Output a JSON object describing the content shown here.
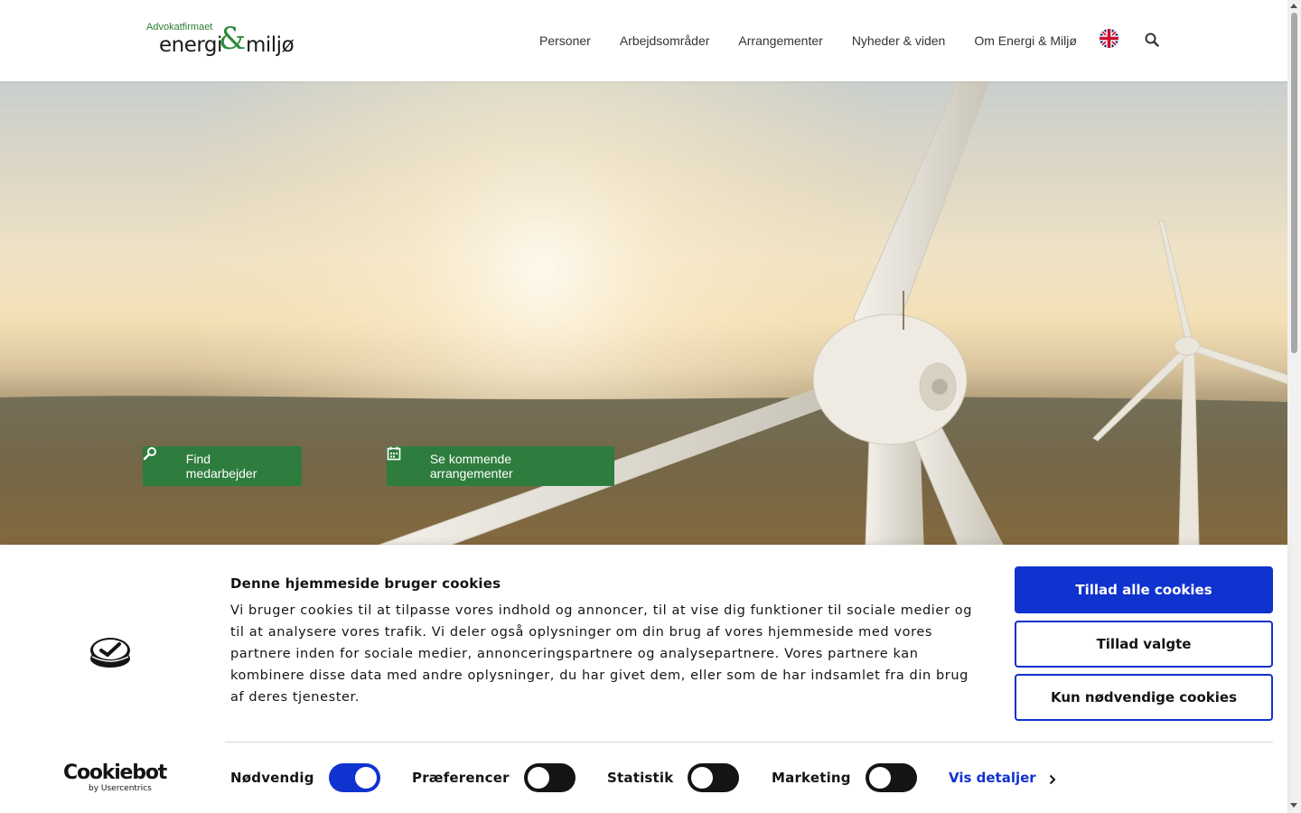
{
  "header": {
    "logo": {
      "small": "Advokatfirmaet",
      "word1": "energi",
      "amp": "&",
      "word2": "miljø"
    },
    "nav": [
      {
        "label": "Personer"
      },
      {
        "label": "Arbejdsområder"
      },
      {
        "label": "Arrangementer"
      },
      {
        "label": "Nyheder & viden"
      },
      {
        "label": "Om Energi & Miljø"
      }
    ],
    "language_icon": "uk-flag-icon",
    "search_icon": "search-icon"
  },
  "hero": {
    "buttons": {
      "find_label": "Find medarbejder",
      "find_icon": "magnifier-icon",
      "events_label": "Se kommende arrangementer",
      "events_icon": "calendar-icon"
    },
    "button_color": "#2e7d3e"
  },
  "cookie_banner": {
    "title": "Denne hjemmeside bruger cookies",
    "text": "Vi bruger cookies til at tilpasse vores indhold og annoncer, til at vise dig funktioner til sociale medier og til at analysere vores trafik. Vi deler også oplysninger om din brug af vores hjemmeside med vores partnere inden for sociale medier, annonceringspartnere og analysepartnere. Vores partnere kan kombinere disse data med andre oplysninger, du har givet dem, eller som de har indsamlet fra din brug af deres tjenester.",
    "buttons": {
      "allow_all": "Tillad alle cookies",
      "allow_selected": "Tillad valgte",
      "necessary_only": "Kun nødvendige cookies"
    },
    "toggles": [
      {
        "label": "Nødvendig",
        "on": true
      },
      {
        "label": "Præferencer",
        "on": false
      },
      {
        "label": "Statistik",
        "on": false
      },
      {
        "label": "Marketing",
        "on": false
      }
    ],
    "details_link": "Vis detaljer",
    "brand": {
      "name": "Cookiebot",
      "sub": "by Usercentrics"
    },
    "accent_color": "#1032cf"
  }
}
